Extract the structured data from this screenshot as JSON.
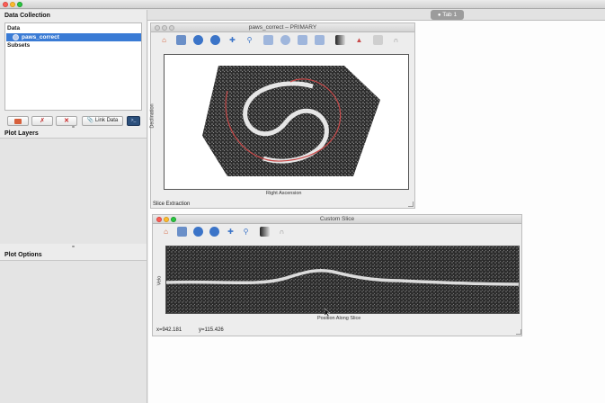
{
  "app": {
    "tab_label": "Tab 1"
  },
  "data_collection": {
    "title": "Data Collection",
    "root_label": "Data",
    "selected_item": "paws_correct",
    "subsets_label": "Subsets",
    "link_data_label": "Link Data"
  },
  "plot_layers": {
    "title": "Plot Layers"
  },
  "plot_options": {
    "title": "Plot Options"
  },
  "image_window": {
    "title": "paws_correct – PRIMARY",
    "xlabel": "Right Ascension",
    "ylabel": "Declination",
    "status": "Slice Extraction"
  },
  "slice_window": {
    "title": "Custom Slice",
    "xlabel": "Position Along Slice",
    "ylabel": "Velo",
    "coord_x": "x=942.181",
    "coord_y": "y=115.426"
  },
  "colors": {
    "selection": "#3a7bd5",
    "accent": "#3b74c8",
    "slice_line": "#c84a4a"
  },
  "icons": [
    "home-icon",
    "save-icon",
    "back-icon",
    "forward-icon",
    "pan-icon",
    "zoom-icon",
    "colormap-icon",
    "contour-icon"
  ]
}
